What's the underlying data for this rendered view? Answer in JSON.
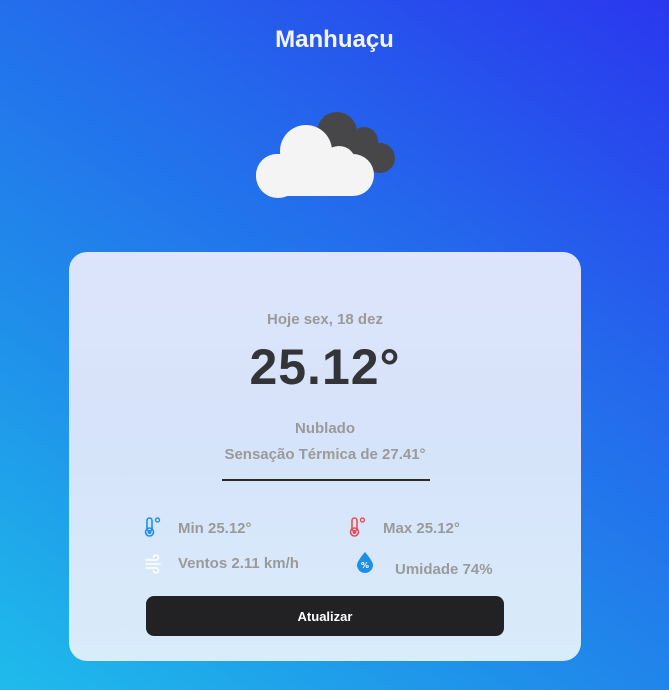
{
  "city": "Manhuaçu",
  "icon": "cloudy-icon",
  "card": {
    "date": "Hoje sex, 18 dez",
    "temperature": "25.12°",
    "condition": "Nublado",
    "feels_like": "Sensação Térmica de 27.41°"
  },
  "stats": {
    "min": "Min 25.12°",
    "max": "Max 25.12°",
    "wind": "Ventos 2.11 km/h",
    "humidity": "Umidade 74%"
  },
  "refresh_label": "Atualizar",
  "colors": {
    "accent": "#2468ec",
    "button": "#222224",
    "temp_min_icon": "#1d8fe6",
    "temp_max_icon": "#e0505a"
  }
}
